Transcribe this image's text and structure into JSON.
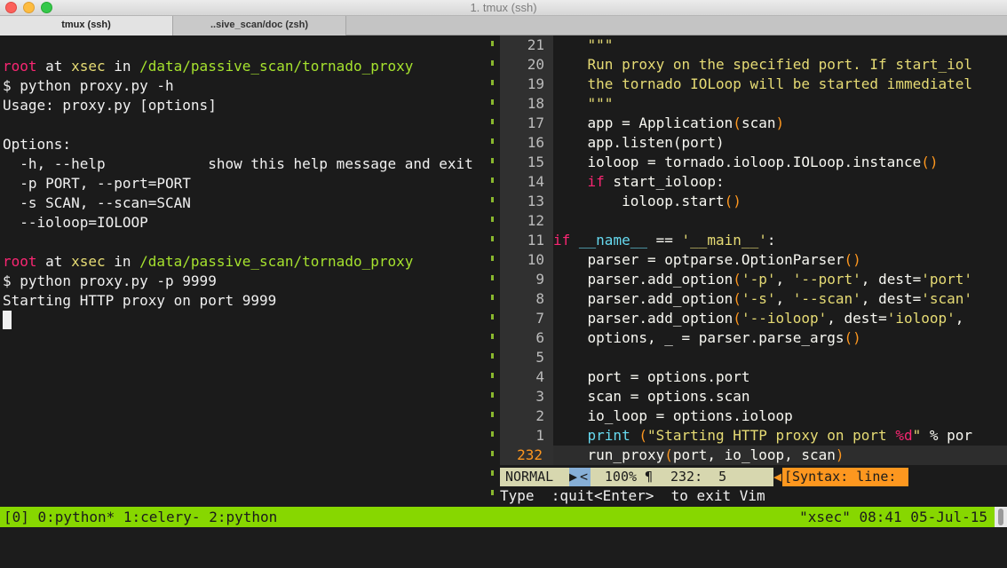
{
  "window": {
    "title": "1. tmux (ssh)",
    "tabs": [
      {
        "label": "tmux (ssh)"
      },
      {
        "label": "..sive_scan/doc (zsh)"
      }
    ]
  },
  "left_pane": {
    "prompt1": {
      "user": "root",
      "at": " at ",
      "host": "xsec",
      "in": " in ",
      "path": "/data/passive_scan/tornado_proxy"
    },
    "lines": [
      "$ python proxy.py -h",
      "Usage: proxy.py [options]",
      "",
      "Options:",
      "  -h, --help            show this help message and exit",
      "  -p PORT, --port=PORT",
      "  -s SCAN, --scan=SCAN",
      "  --ioloop=IOLOOP"
    ],
    "prompt2": {
      "user": "root",
      "at": " at ",
      "host": "xsec",
      "in": " in ",
      "path": "/data/passive_scan/tornado_proxy"
    },
    "lines2": [
      "$ python proxy.py -p 9999",
      "Starting HTTP proxy on port 9999"
    ]
  },
  "vim": {
    "line_numbers": [
      "21",
      "20",
      "19",
      "18",
      "17",
      "16",
      "15",
      "14",
      "13",
      "12",
      "11",
      "10",
      "9",
      "8",
      "7",
      "6",
      "5",
      "4",
      "3",
      "2",
      "1",
      "232"
    ],
    "code": {
      "l21": "    \"\"\"",
      "l20": "    Run proxy on the specified port. If start_iol",
      "l19": "    the tornado IOLoop will be started immediatel",
      "l18": "    \"\"\"",
      "l17a": "    app = Application",
      "l17b": "(",
      "l17c": "scan",
      "l17d": ")",
      "l16": "    app.listen(port)",
      "l15a": "    ioloop = tornado.ioloop.IOLoop.instance",
      "l15b": "()",
      "l14a": "    ",
      "l14b": "if",
      "l14c": " start_ioloop:",
      "l13a": "        ioloop.start",
      "l13b": "()",
      "l12": "",
      "l11a": "if",
      "l11b": " ",
      "l11c": "__name__",
      "l11d": " == ",
      "l11e": "'__main__'",
      "l11f": ":",
      "l10a": "    parser = optparse.OptionParser",
      "l10b": "()",
      "l9a": "    parser.add_option",
      "l9b": "(",
      "l9c": "'-p'",
      "l9d": ", ",
      "l9e": "'--port'",
      "l9f": ", dest=",
      "l9g": "'port'",
      "l8a": "    parser.add_option",
      "l8b": "(",
      "l8c": "'-s'",
      "l8d": ", ",
      "l8e": "'--scan'",
      "l8f": ", dest=",
      "l8g": "'scan'",
      "l7a": "    parser.add_option",
      "l7b": "(",
      "l7c": "'--ioloop'",
      "l7d": ", dest=",
      "l7e": "'ioloop'",
      "l7f": ",",
      "l6a": "    options, _ = parser.parse_args",
      "l6b": "()",
      "l5": "",
      "l4": "    port = options.port",
      "l3": "    scan = options.scan",
      "l2": "    io_loop = options.ioloop",
      "l1a": "    ",
      "l1b": "print",
      "l1c": " (",
      "l1d": "\"Starting HTTP proxy on port ",
      "l1e": "%d",
      "l1f": "\"",
      "l1g": " % por",
      "l232a": "    run_proxy",
      "l232b": "(",
      "l232c": "port, io_loop, scan",
      "l232d": ")"
    },
    "statusline": {
      "mode": "NORMAL",
      "arrow1": "▶",
      "arrow2": "<",
      "percent": "100% ¶",
      "position": "232:  5",
      "sep": "◀",
      "syntax": "[Syntax: line:"
    },
    "message": "Type  :quit<Enter>  to exit Vim"
  },
  "tmux": {
    "left": "[0] 0:python* 1:celery- 2:python",
    "right": "\"xsec\" 08:41 05-Jul-15"
  },
  "colors": {
    "tmux_bar": "#87d700",
    "prompt_user": "#f92672",
    "prompt_host": "#e6db74",
    "prompt_path": "#a6e22e",
    "vim_mode": "#d7d7af",
    "vim_syntax": "#fd971f"
  }
}
